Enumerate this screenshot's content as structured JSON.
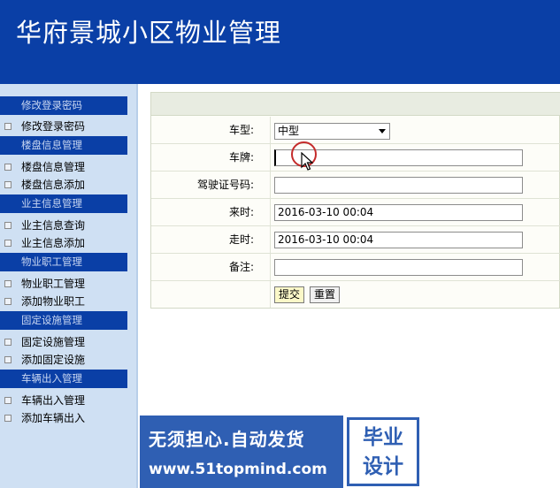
{
  "header": {
    "title": "华府景城小区物业管理"
  },
  "sidebar": {
    "sections": [
      {
        "title": "修改登录密码",
        "items": [
          "修改登录密码"
        ]
      },
      {
        "title": "楼盘信息管理",
        "items": [
          "楼盘信息管理",
          "楼盘信息添加"
        ]
      },
      {
        "title": "业主信息管理",
        "items": [
          "业主信息查询",
          "业主信息添加"
        ]
      },
      {
        "title": "物业职工管理",
        "items": [
          "物业职工管理",
          "添加物业职工"
        ]
      },
      {
        "title": "固定设施管理",
        "items": [
          "固定设施管理",
          "添加固定设施"
        ]
      },
      {
        "title": "车辆出入管理",
        "items": [
          "车辆出入管理",
          "添加车辆出入"
        ]
      }
    ]
  },
  "form": {
    "car_type": {
      "label": "车型:",
      "value": "中型"
    },
    "plate": {
      "label": "车牌:",
      "value": ""
    },
    "license": {
      "label": "驾驶证号码:",
      "value": ""
    },
    "arrive": {
      "label": "来时:",
      "value": "2016-03-10 00:04"
    },
    "leave": {
      "label": "走时:",
      "value": "2016-03-10 00:04"
    },
    "remark": {
      "label": "备注:",
      "value": ""
    },
    "submit_label": "提交",
    "reset_label": "重置"
  },
  "watermark": {
    "line1": "无须担心.自动发货",
    "line2": "www.51topmind.com",
    "badge_top": "毕业",
    "badge_bottom": "设计"
  }
}
